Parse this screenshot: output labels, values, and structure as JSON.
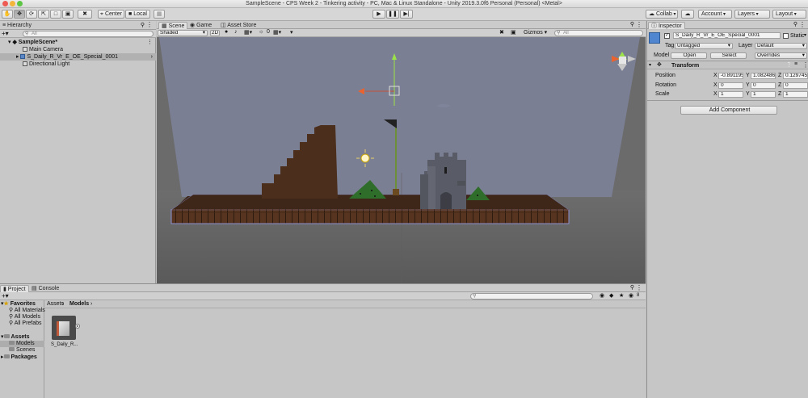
{
  "window": {
    "title": "SampleScene - CPS Week 2 - Tinkering activity - PC, Mac & Linux Standalone - Unity 2019.3.0f6 Personal (Personal) <Metal>"
  },
  "toolbar": {
    "center_label": "Center",
    "local_label": "Local",
    "collab_label": "Collab",
    "account_label": "Account",
    "layers_label": "Layers",
    "layout_label": "Layout"
  },
  "hierarchy": {
    "tab_label": "Hierarchy",
    "search_placeholder": "All",
    "scene_name": "SampleScene*",
    "items": [
      {
        "label": "Main Camera"
      },
      {
        "label": "S_Daily_R_Vr_E_OE_Special_0001"
      },
      {
        "label": "Directional Light"
      }
    ]
  },
  "scene": {
    "tabs": [
      {
        "label": "Scene"
      },
      {
        "label": "Game"
      },
      {
        "label": "Asset Store"
      }
    ],
    "shading_mode": "Shaded",
    "mode_2d": "2D",
    "hidden_count": "0",
    "gizmos_label": "Gizmos",
    "search_placeholder": "All"
  },
  "inspector": {
    "tab_label": "Inspector",
    "object_name": "S_Daily_R_Vr_E_OE_Special_0001",
    "static_label": "Static",
    "tag_label": "Tag",
    "tag_value": "Untagged",
    "layer_label": "Layer",
    "layer_value": "Default",
    "model_label": "Model",
    "open_label": "Open",
    "select_label": "Select",
    "overrides_label": "Overrides",
    "transform_title": "Transform",
    "position_label": "Position",
    "rotation_label": "Rotation",
    "scale_label": "Scale",
    "axis_x": "X",
    "axis_y": "Y",
    "axis_z": "Z",
    "position": {
      "x": "-0.891195",
      "y": "1.082486",
      "z": "0.129745"
    },
    "rotation": {
      "x": "0",
      "y": "0",
      "z": "0"
    },
    "scale": {
      "x": "1",
      "y": "1",
      "z": "1"
    },
    "add_component_label": "Add Component"
  },
  "project": {
    "tabs": [
      {
        "label": "Project"
      },
      {
        "label": "Console"
      }
    ],
    "favorites_label": "Favorites",
    "favorites": [
      {
        "label": "All Materials"
      },
      {
        "label": "All Models"
      },
      {
        "label": "All Prefabs"
      }
    ],
    "assets_label": "Assets",
    "asset_folders": [
      {
        "label": "Models"
      },
      {
        "label": "Scenes"
      }
    ],
    "packages_label": "Packages",
    "breadcrumb_root": "Assets",
    "breadcrumb_current": "Models",
    "asset_tile_label": "S_Daily_R...",
    "hidden_count": "8"
  },
  "colors": {
    "accent_blue": "#3b7bd4",
    "sky": "#7b7f93",
    "ground_dark": "#3f2718",
    "brick": "#5a3622",
    "grass": "#2e6a2a",
    "castle": "#5a5c66"
  }
}
